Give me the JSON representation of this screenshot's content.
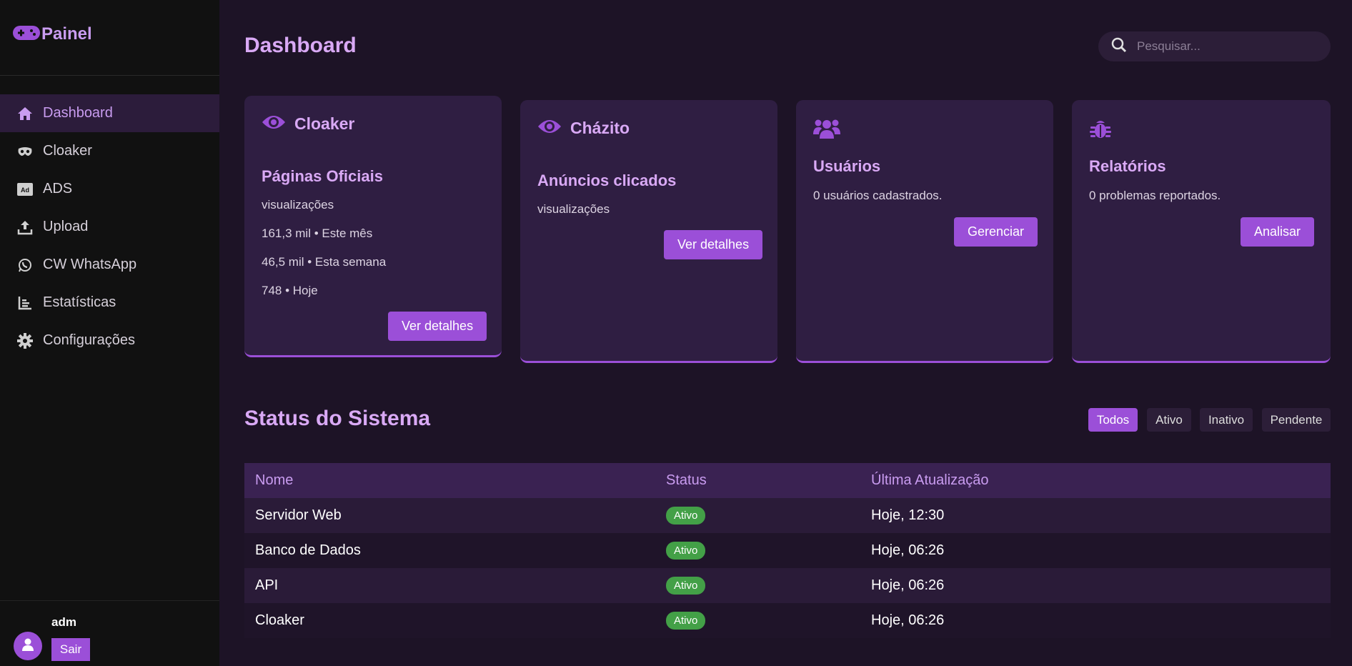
{
  "brand": {
    "name": "Painel",
    "icon": "gamepad-icon"
  },
  "sidebar": {
    "items": [
      {
        "label": "Dashboard",
        "icon": "home-icon",
        "active": true
      },
      {
        "label": "Cloaker",
        "icon": "mask-icon",
        "active": false
      },
      {
        "label": "ADS",
        "icon": "ad-icon",
        "active": false
      },
      {
        "label": "Upload",
        "icon": "upload-icon",
        "active": false
      },
      {
        "label": "CW WhatsApp",
        "icon": "whatsapp-icon",
        "active": false
      },
      {
        "label": "Estatísticas",
        "icon": "chart-icon",
        "active": false
      },
      {
        "label": "Configurações",
        "icon": "gear-icon",
        "active": false
      }
    ],
    "user": {
      "name": "adm",
      "logout_label": "Sair"
    }
  },
  "header": {
    "title": "Dashboard",
    "search_placeholder": "Pesquisar..."
  },
  "cards": [
    {
      "title": "Cloaker",
      "icon": "eye-icon",
      "subtitle": "Páginas Oficiais",
      "lines": [
        "visualizações",
        "161,3 mil • Este mês",
        "46,5 mil • Esta semana",
        "748 • Hoje"
      ],
      "button": "Ver detalhes"
    },
    {
      "title": "Cházito",
      "icon": "eye-icon",
      "subtitle": "Anúncios clicados",
      "lines": [
        "visualizações"
      ],
      "button": "Ver detalhes"
    },
    {
      "title": "Usuários",
      "icon": "users-icon",
      "text": "0 usuários cadastrados.",
      "button": "Gerenciar"
    },
    {
      "title": "Relatórios",
      "icon": "bug-icon",
      "text": "0 problemas reportados.",
      "button": "Analisar"
    }
  ],
  "status": {
    "title": "Status do Sistema",
    "filters": [
      "Todos",
      "Ativo",
      "Inativo",
      "Pendente"
    ],
    "active_filter": "Todos",
    "columns": [
      "Nome",
      "Status",
      "Última Atualização"
    ],
    "rows": [
      {
        "name": "Servidor Web",
        "status": "Ativo",
        "updated": "Hoje, 12:30"
      },
      {
        "name": "Banco de Dados",
        "status": "Ativo",
        "updated": "Hoje, 06:26"
      },
      {
        "name": "API",
        "status": "Ativo",
        "updated": "Hoje, 06:26"
      },
      {
        "name": "Cloaker",
        "status": "Ativo",
        "updated": "Hoje, 06:26"
      }
    ]
  },
  "colors": {
    "accent": "#9b4fd8",
    "title": "#d9a9f5",
    "success": "#43a047"
  }
}
